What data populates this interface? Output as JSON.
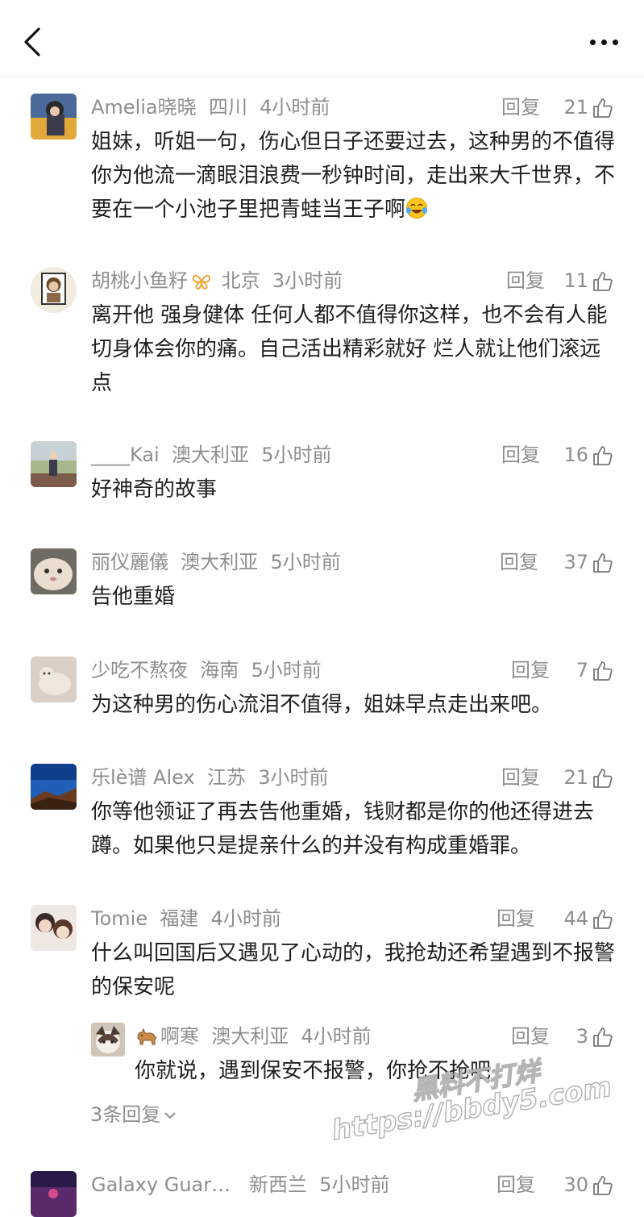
{
  "header": {
    "back_icon": "chevron-left-icon",
    "more_icon": "ellipsis-icon"
  },
  "comments": [
    {
      "user": "Amelia晓晓",
      "location": "四川",
      "time": "4小时前",
      "reply_label": "回复",
      "likes": "21",
      "text": "姐妹，听姐一句，伤心但日子还要过去，这种男的不值得你为他流一滴眼泪浪费一秒钟时间，走出来大千世界，不要在一个小池子里把青蛙当王子啊"
    },
    {
      "user": "胡桃小鱼籽",
      "location": "北京",
      "time": "3小时前",
      "reply_label": "回复",
      "likes": "11",
      "text": "离开他 强身健体 任何人都不值得你这样，也不会有人能切身体会你的痛。自己活出精彩就好 烂人就让他们滚远点"
    },
    {
      "user": "____Kai",
      "location": "澳大利亚",
      "time": "5小时前",
      "reply_label": "回复",
      "likes": "16",
      "text": "好神奇的故事"
    },
    {
      "user": "丽仪麗儀",
      "location": "澳大利亚",
      "time": "5小时前",
      "reply_label": "回复",
      "likes": "37",
      "text": "告他重婚"
    },
    {
      "user": "少吃不熬夜",
      "location": "海南",
      "time": "5小时前",
      "reply_label": "回复",
      "likes": "7",
      "text": "为这种男的伤心流泪不值得，姐妹早点走出来吧。"
    },
    {
      "user": "乐lè谱 Alex",
      "location": "江苏",
      "time": "3小时前",
      "reply_label": "回复",
      "likes": "21",
      "text": "你等他领证了再去告他重婚，钱财都是你的他还得进去蹲。如果他只是提亲什么的并没有构成重婚罪。"
    },
    {
      "user": "Tomie",
      "location": "福建",
      "time": "4小时前",
      "reply_label": "回复",
      "likes": "44",
      "text": "什么叫回国后又遇见了心动的，我抢劫还希望遇到不报警的保安呢"
    },
    {
      "user": "啊寒",
      "location": "澳大利亚",
      "time": "4小时前",
      "reply_label": "回复",
      "likes": "3",
      "text": "你就说，遇到保安不报警，你抢不抢吧"
    },
    {
      "user": "Galaxy Guar…",
      "location": "新西兰",
      "time": "5小时前",
      "reply_label": "回复",
      "likes": "30",
      "text": ""
    }
  ],
  "more_replies_label": "3条回复",
  "watermark": {
    "line1": "黑料不打烊",
    "line2": "https://bbdy5.com"
  },
  "colors": {
    "meta": "#8e8e8e",
    "body_text": "#1f1f1f",
    "badge": "#f0a02a"
  }
}
